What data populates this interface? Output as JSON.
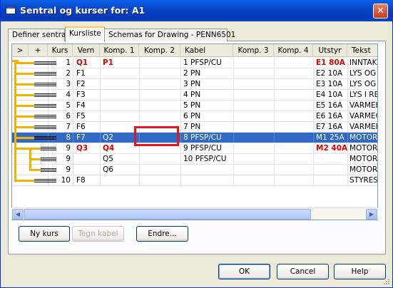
{
  "window": {
    "title": "Sentral og kurser for: A1",
    "close_label": "✕"
  },
  "tabs": [
    {
      "label": "Definer sentral"
    },
    {
      "label": "Kursliste"
    },
    {
      "label": "Schemas for Drawing - PENN6501"
    }
  ],
  "grid": {
    "columns": [
      ">",
      "+",
      "Kurs",
      "Vern",
      "Komp. 1",
      "Komp. 2",
      "Kabel",
      "Komp. 3",
      "Komp. 4",
      "Utstyr",
      "Tekst"
    ],
    "rows": [
      {
        "kurs": "1",
        "vern": "Q1",
        "komp1": "P1",
        "komp2": "",
        "kabel": "1 PFSP/CU",
        "komp3": "",
        "komp4": "",
        "utstyr": "E1 80A",
        "tekst": "INNTAK",
        "highlight": true,
        "selected": false
      },
      {
        "kurs": "2",
        "vern": "F1",
        "komp1": "",
        "komp2": "",
        "kabel": "2 PN",
        "komp3": "",
        "komp4": "",
        "utstyr": "E2 10A",
        "tekst": "LYS OG",
        "highlight": false,
        "selected": false
      },
      {
        "kurs": "3",
        "vern": "F2",
        "komp1": "",
        "komp2": "",
        "kabel": "3 PN",
        "komp3": "",
        "komp4": "",
        "utstyr": "E3 10A",
        "tekst": "LYS OG",
        "highlight": false,
        "selected": false
      },
      {
        "kurs": "4",
        "vern": "F3",
        "komp1": "",
        "komp2": "",
        "kabel": "4 PN",
        "komp3": "",
        "komp4": "",
        "utstyr": "E4 10A",
        "tekst": "LYS I RE",
        "highlight": false,
        "selected": false
      },
      {
        "kurs": "5",
        "vern": "F4",
        "komp1": "",
        "komp2": "",
        "kabel": "5 PN",
        "komp3": "",
        "komp4": "",
        "utstyr": "E5 16A",
        "tekst": "VARMEK",
        "highlight": false,
        "selected": false
      },
      {
        "kurs": "6",
        "vern": "F5",
        "komp1": "",
        "komp2": "",
        "kabel": "6 PN",
        "komp3": "",
        "komp4": "",
        "utstyr": "E6 16A",
        "tekst": "VARMEC",
        "highlight": false,
        "selected": false
      },
      {
        "kurs": "7",
        "vern": "F6",
        "komp1": "",
        "komp2": "",
        "kabel": "7 PN",
        "komp3": "",
        "komp4": "",
        "utstyr": "E7 16A",
        "tekst": "VARMEK",
        "highlight": false,
        "selected": false
      },
      {
        "kurs": "8",
        "vern": "F7",
        "komp1": "Q2",
        "komp2": "",
        "kabel": "8 PFSP/CU",
        "komp3": "",
        "komp4": "",
        "utstyr": "M1 25A",
        "tekst": "MOTOR",
        "highlight": false,
        "selected": true
      },
      {
        "kurs": "9",
        "vern": "Q3",
        "komp1": "Q4",
        "komp2": "",
        "kabel": "9 PFSP/CU",
        "komp3": "",
        "komp4": "",
        "utstyr": "M2 40A",
        "tekst": "MOTOR",
        "highlight": true,
        "selected": false
      },
      {
        "kurs": "9",
        "vern": "",
        "komp1": "Q5",
        "komp2": "",
        "kabel": "10 PFSP/CU",
        "komp3": "",
        "komp4": "",
        "utstyr": "",
        "tekst": "MOTOR",
        "highlight": false,
        "selected": false
      },
      {
        "kurs": "9",
        "vern": "",
        "komp1": "Q6",
        "komp2": "",
        "kabel": "",
        "komp3": "",
        "komp4": "",
        "utstyr": "",
        "tekst": "MOTOR",
        "highlight": false,
        "selected": false
      },
      {
        "kurs": "10",
        "vern": "F8",
        "komp1": "",
        "komp2": "",
        "kabel": "",
        "komp3": "",
        "komp4": "",
        "utstyr": "",
        "tekst": "STYRES",
        "highlight": false,
        "selected": false
      }
    ]
  },
  "buttons": {
    "ny_kurs": "Ny kurs",
    "tegn_kabel": "Tegn kabel",
    "endre": "Endre...",
    "ok": "OK",
    "cancel": "Cancel",
    "help": "Help"
  },
  "colors": {
    "selection": "#316AC5",
    "highlight_text": "#E00000",
    "tree_line": "#F0B400",
    "annotation_box": "#E8141B"
  }
}
